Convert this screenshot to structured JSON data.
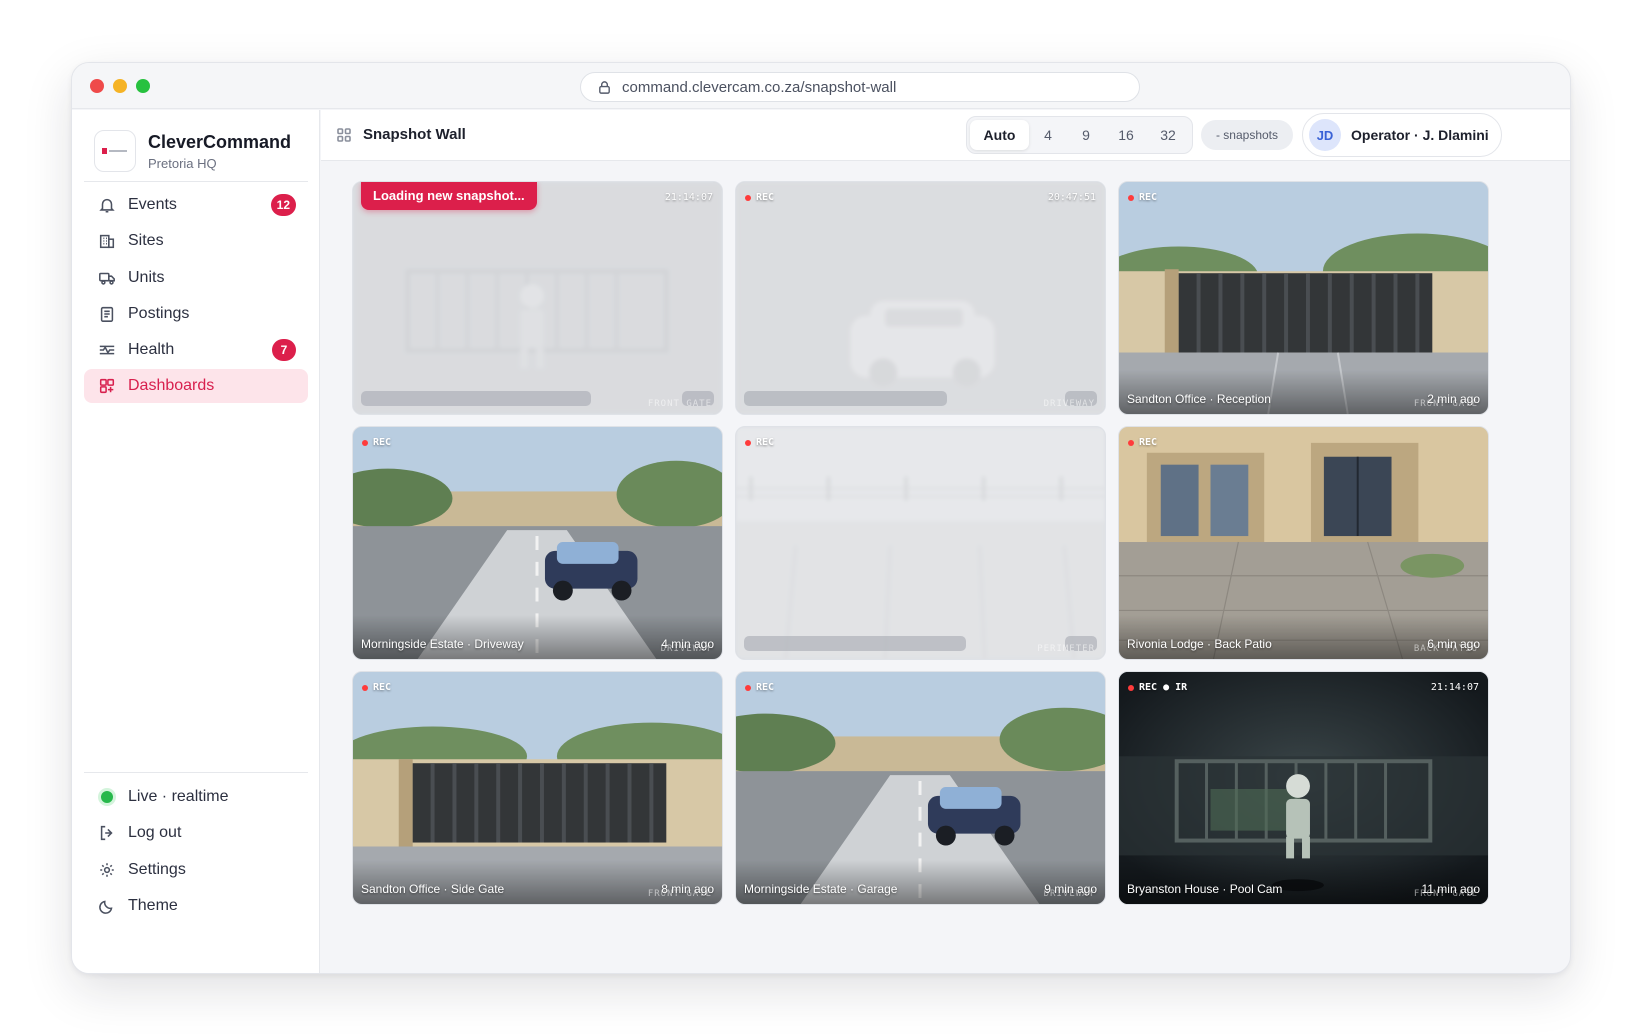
{
  "browser": {
    "url": "command.clevercam.co.za/snapshot-wall"
  },
  "brand": {
    "name": "CleverCommand",
    "site": "Pretoria HQ",
    "logo_icon": "clevercam-logo-icon"
  },
  "nav": [
    {
      "label": "Events",
      "icon": "bell-icon",
      "badge": "12"
    },
    {
      "label": "Sites",
      "icon": "building-icon"
    },
    {
      "label": "Units",
      "icon": "truck-icon"
    },
    {
      "label": "Postings",
      "icon": "clipboard-icon"
    },
    {
      "label": "Health",
      "icon": "pulse-icon",
      "badge": "7"
    },
    {
      "label": "Dashboards",
      "icon": "grid-icon",
      "active": true
    }
  ],
  "bottom_nav": {
    "status": "Live · realtime",
    "status_color": "#27b84b",
    "logout": "Log out",
    "settings": "Settings",
    "theme": "Theme"
  },
  "topbar": {
    "title": "Snapshot Wall",
    "layout_options": [
      "Auto",
      "4",
      "9",
      "16",
      "32"
    ],
    "selected_layout": "Auto",
    "snapshots_chip": "- snapshots",
    "operator_initials": "JD",
    "operator_name": "Operator · J. Dlamini"
  },
  "accent_color": "#dc1f4b",
  "tiles": [
    {
      "state": "loading",
      "loading_text": "Loading new snapshot...",
      "rec": "",
      "stamp": "21:14:07",
      "zone": "FRONT GATE",
      "scene": "night-gate-person"
    },
    {
      "state": "stale",
      "rec": "REC",
      "stamp": "20:47:51",
      "zone": "DRIVEWAY",
      "scene": "driveway-car"
    },
    {
      "state": "ok",
      "rec": "REC",
      "name": "Sandton Office · Reception",
      "age": "2 min ago",
      "zone": "FRONT GATE",
      "scene": "gate"
    },
    {
      "state": "ok",
      "rec": "REC",
      "name": "Morningside Estate · Driveway",
      "age": "4 min ago",
      "zone": "DRIVEWAY",
      "scene": "driveway"
    },
    {
      "state": "stale",
      "rec": "REC",
      "zone": "PERIMETER",
      "scene": "perimeter"
    },
    {
      "state": "ok",
      "rec": "REC",
      "name": "Rivonia Lodge · Back Patio",
      "age": "6 min ago",
      "zone": "BACK PATIO",
      "scene": "patio"
    },
    {
      "state": "ok",
      "rec": "REC",
      "name": "Sandton Office · Side Gate",
      "age": "8 min ago",
      "zone": "FRONT GATE",
      "scene": "gate"
    },
    {
      "state": "ok",
      "rec": "REC",
      "name": "Morningside Estate · Garage",
      "age": "9 min ago",
      "zone": "DRIVEWAY",
      "scene": "driveway"
    },
    {
      "state": "ok",
      "rec": "REC ● IR",
      "stamp": "21:14:07",
      "name": "Bryanston House · Pool Cam",
      "age": "11 min ago",
      "zone": "FRONT GATE",
      "scene": "night"
    }
  ]
}
